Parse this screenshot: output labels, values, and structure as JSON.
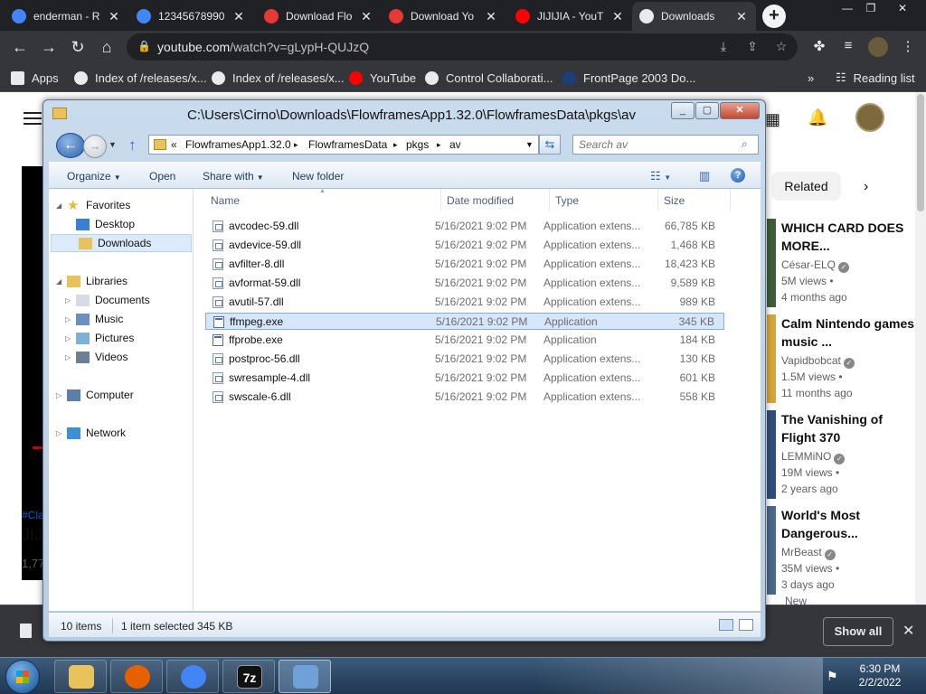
{
  "chrome": {
    "tabs": [
      {
        "title": "enderman - R",
        "favicon_color": "#4285f4",
        "active": false
      },
      {
        "title": "12345678990",
        "favicon_color": "#4285f4",
        "active": false
      },
      {
        "title": "Download Flo",
        "favicon_color": "#e53935",
        "active": false
      },
      {
        "title": "Download Yo",
        "favicon_color": "#e53935",
        "active": false
      },
      {
        "title": "JIJIJIA - YouT",
        "favicon_color": "#ff0000",
        "active": false
      },
      {
        "title": "Downloads",
        "favicon_color": "#e8eaed",
        "active": true
      }
    ],
    "new_tab": "+",
    "window_controls": {
      "minimize": "—",
      "restore": "❐",
      "close": "✕"
    },
    "nav": {
      "back": "←",
      "forward": "→",
      "reload": "↻",
      "home": "⌂"
    },
    "url_domain": "youtube.com",
    "url_path": "/watch?v=gLypH-QUJzQ",
    "bookmarks": [
      {
        "label": "Apps",
        "icon": "apps-grid-icon",
        "color": "#e8eaed"
      },
      {
        "label": "Index of /releases/x...",
        "icon": "globe-icon",
        "color": "#e8eaed"
      },
      {
        "label": "Index of /releases/x...",
        "icon": "globe-icon",
        "color": "#e8eaed"
      },
      {
        "label": "YouTube",
        "icon": "youtube-icon",
        "color": "#ff0000"
      },
      {
        "label": "Control Collaborati...",
        "icon": "globe-icon",
        "color": "#e8eaed"
      },
      {
        "label": "FrontPage 2003 Do...",
        "icon": "frontpage-icon",
        "color": "#1a3f7a"
      }
    ],
    "bookmarks_more": "»",
    "reading_list": "Reading list"
  },
  "youtube": {
    "hashtag": "#Cla",
    "title_fragment": "JIJ",
    "views_fragment": "1,77",
    "related_chip": "Related",
    "related": [
      {
        "title": "WHICH CARD DOES MORE...",
        "channel": "César-ELQ",
        "views": "5M views •",
        "age": "4 months ago",
        "thumb": "#3f5f3a"
      },
      {
        "title": "Calm Nintendo games music ...",
        "channel": "Vapidbobcat",
        "views": "1.5M views •",
        "age": "11 months ago",
        "thumb": "#d8a53a"
      },
      {
        "title": "The Vanishing of Flight 370",
        "channel": "LEMMiNO",
        "views": "19M views •",
        "age": "2 years ago",
        "thumb": "#2f4f7a"
      },
      {
        "title": "World's Most Dangerous...",
        "channel": "MrBeast",
        "views": "35M views •",
        "age": "3 days ago",
        "thumb": "#4b6a8a"
      }
    ],
    "new_badge": "New"
  },
  "downloads_bar": {
    "show_all": "Show all",
    "close": "✕"
  },
  "explorer": {
    "title": "C:\\Users\\Cirno\\Downloads\\FlowframesApp1.32.0\\FlowframesData\\pkgs\\av",
    "breadcrumb": [
      "«",
      "FlowframesApp1.32.0",
      "▸",
      "FlowframesData",
      "▸",
      "pkgs",
      "▸",
      "av"
    ],
    "search_placeholder": "Search av",
    "commands": {
      "organize": "Organize",
      "open": "Open",
      "share_with": "Share with",
      "new_folder": "New folder"
    },
    "nav_tree": [
      {
        "label": "Favorites",
        "icon": "star-icon",
        "color": "#e8b93a",
        "level": 0,
        "expander": "◢"
      },
      {
        "label": "Desktop",
        "icon": "desktop-icon",
        "color": "#3a7fd0",
        "level": 1
      },
      {
        "label": "Downloads",
        "icon": "downloads-folder-icon",
        "color": "#e8c25c",
        "level": 1,
        "selected": true
      },
      {
        "label": "Libraries",
        "icon": "libraries-icon",
        "color": "#e8c25c",
        "level": 0,
        "expander": "◢"
      },
      {
        "label": "Documents",
        "icon": "documents-icon",
        "color": "#d7dce4",
        "level": 1,
        "expander": "▷"
      },
      {
        "label": "Music",
        "icon": "music-icon",
        "color": "#6d8fbf",
        "level": 1,
        "expander": "▷"
      },
      {
        "label": "Pictures",
        "icon": "pictures-icon",
        "color": "#7fb0d8",
        "level": 1,
        "expander": "▷"
      },
      {
        "label": "Videos",
        "icon": "videos-icon",
        "color": "#6d7f95",
        "level": 1,
        "expander": "▷"
      },
      {
        "label": "Computer",
        "icon": "computer-icon",
        "color": "#5b7fa8",
        "level": 0,
        "expander": "▷"
      },
      {
        "label": "Network",
        "icon": "network-icon",
        "color": "#3e8fd3",
        "level": 0,
        "expander": "▷"
      }
    ],
    "columns": [
      "Name",
      "Date modified",
      "Type",
      "Size"
    ],
    "files": [
      {
        "name": "avcodec-59.dll",
        "date": "5/16/2021 9:02 PM",
        "type": "Application extens...",
        "size": "66,785 KB",
        "kind": "dll"
      },
      {
        "name": "avdevice-59.dll",
        "date": "5/16/2021 9:02 PM",
        "type": "Application extens...",
        "size": "1,468 KB",
        "kind": "dll"
      },
      {
        "name": "avfilter-8.dll",
        "date": "5/16/2021 9:02 PM",
        "type": "Application extens...",
        "size": "18,423 KB",
        "kind": "dll"
      },
      {
        "name": "avformat-59.dll",
        "date": "5/16/2021 9:02 PM",
        "type": "Application extens...",
        "size": "9,589 KB",
        "kind": "dll"
      },
      {
        "name": "avutil-57.dll",
        "date": "5/16/2021 9:02 PM",
        "type": "Application extens...",
        "size": "989 KB",
        "kind": "dll"
      },
      {
        "name": "ffmpeg.exe",
        "date": "5/16/2021 9:02 PM",
        "type": "Application",
        "size": "345 KB",
        "kind": "exe",
        "selected": true
      },
      {
        "name": "ffprobe.exe",
        "date": "5/16/2021 9:02 PM",
        "type": "Application",
        "size": "184 KB",
        "kind": "exe"
      },
      {
        "name": "postproc-56.dll",
        "date": "5/16/2021 9:02 PM",
        "type": "Application extens...",
        "size": "130 KB",
        "kind": "dll"
      },
      {
        "name": "swresample-4.dll",
        "date": "5/16/2021 9:02 PM",
        "type": "Application extens...",
        "size": "601 KB",
        "kind": "dll"
      },
      {
        "name": "swscale-6.dll",
        "date": "5/16/2021 9:02 PM",
        "type": "Application extens...",
        "size": "558 KB",
        "kind": "dll"
      }
    ],
    "status": {
      "count": "10 items",
      "selection": "1 item selected  345 KB"
    }
  },
  "taskbar": {
    "apps": [
      {
        "name": "explorer",
        "icon": "file-explorer-icon",
        "color": "#e8c25c"
      },
      {
        "name": "firefox",
        "icon": "firefox-icon",
        "color": "#e66000"
      },
      {
        "name": "chrome",
        "icon": "chrome-icon",
        "color": "#4285f4"
      },
      {
        "name": "7zip",
        "icon": "7zip-icon",
        "label": "7z"
      },
      {
        "name": "control",
        "icon": "control-panel-icon",
        "color": "#6fa0d8"
      }
    ],
    "time": "6:30 PM",
    "date": "2/2/2022"
  }
}
